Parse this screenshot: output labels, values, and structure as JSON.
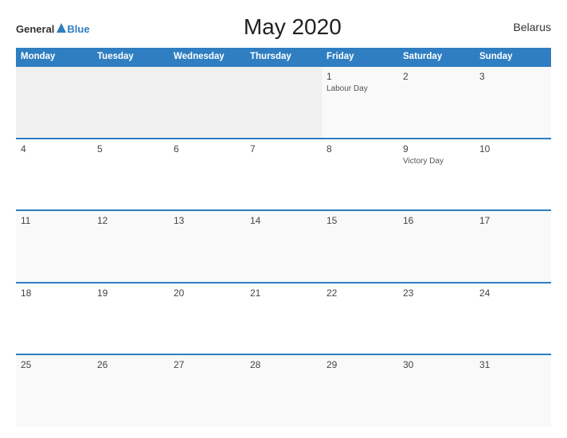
{
  "header": {
    "logo_general": "General",
    "logo_blue": "Blue",
    "title": "May 2020",
    "country": "Belarus"
  },
  "columns": [
    "Monday",
    "Tuesday",
    "Wednesday",
    "Thursday",
    "Friday",
    "Saturday",
    "Sunday"
  ],
  "weeks": [
    [
      {
        "num": "",
        "empty": true
      },
      {
        "num": "",
        "empty": true
      },
      {
        "num": "",
        "empty": true
      },
      {
        "num": "",
        "empty": true
      },
      {
        "num": "1",
        "holiday": "Labour Day"
      },
      {
        "num": "2"
      },
      {
        "num": "3"
      }
    ],
    [
      {
        "num": "4"
      },
      {
        "num": "5"
      },
      {
        "num": "6"
      },
      {
        "num": "7"
      },
      {
        "num": "8"
      },
      {
        "num": "9",
        "holiday": "Victory Day"
      },
      {
        "num": "10"
      }
    ],
    [
      {
        "num": "11"
      },
      {
        "num": "12"
      },
      {
        "num": "13"
      },
      {
        "num": "14"
      },
      {
        "num": "15"
      },
      {
        "num": "16"
      },
      {
        "num": "17"
      }
    ],
    [
      {
        "num": "18"
      },
      {
        "num": "19"
      },
      {
        "num": "20"
      },
      {
        "num": "21"
      },
      {
        "num": "22"
      },
      {
        "num": "23"
      },
      {
        "num": "24"
      }
    ],
    [
      {
        "num": "25"
      },
      {
        "num": "26"
      },
      {
        "num": "27"
      },
      {
        "num": "28"
      },
      {
        "num": "29"
      },
      {
        "num": "30"
      },
      {
        "num": "31"
      }
    ]
  ]
}
